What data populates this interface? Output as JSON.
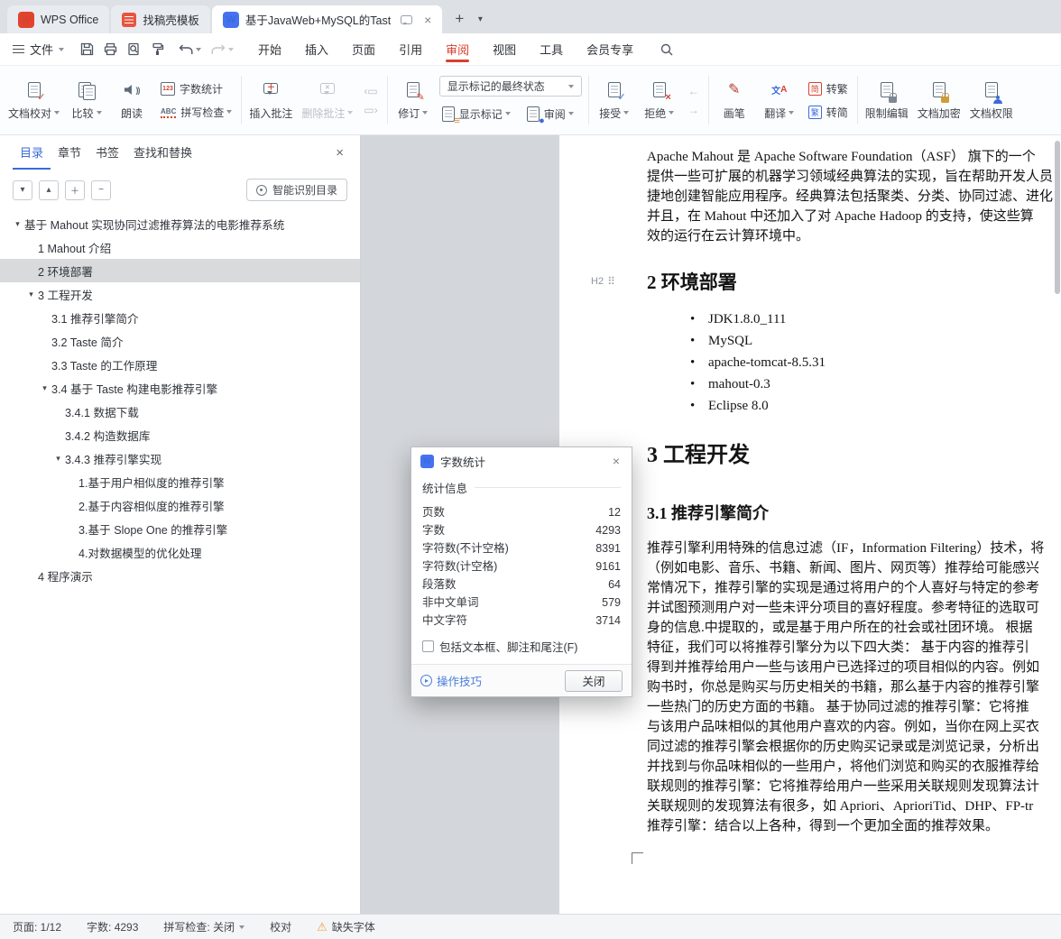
{
  "colors": {
    "accent_red": "#d8402e",
    "accent_blue": "#3b6bda",
    "selection_gray": "#d8dadb",
    "warning_orange": "#efa23b",
    "doc_bg": "#d3d6da"
  },
  "icons": {
    "wps-logo-icon": "red W badge",
    "writer-doc-icon": "blue W badge",
    "template-doc-icon": "red document",
    "search-icon": "magnifier",
    "warning-icon": "⚠",
    "caret-down-icon": "▾",
    "close-icon": "×",
    "check-icon": "✓",
    "lock-icon": "padlock",
    "speaker-icon": "speaker",
    "comment-icon": "speech bubble",
    "pencil-icon": "✎",
    "drag-handle-icon": "⠿"
  },
  "tabbar": {
    "home_label": "WPS Office",
    "template_label": "找稿壳模板",
    "doc_label": "基于JavaWeb+MySQL的Tast"
  },
  "menubar": {
    "file_label": "文件",
    "menus": [
      {
        "label": "开始"
      },
      {
        "label": "插入"
      },
      {
        "label": "页面"
      },
      {
        "label": "引用"
      },
      {
        "label": "审阅",
        "active": true
      },
      {
        "label": "视图"
      },
      {
        "label": "工具"
      },
      {
        "label": "会员专享"
      }
    ]
  },
  "ribbon": {
    "doc_check": "文档校对",
    "compare": "比较",
    "read_aloud": "朗读",
    "word_count": "字数统计",
    "spell_check": "拼写检查",
    "insert_comment": "插入批注",
    "delete_comment": "删除批注",
    "revision": "修订",
    "markup_state": "显示标记的最终状态",
    "show_markup": "显示标记",
    "review": "审阅",
    "accept": "接受",
    "reject": "拒绝",
    "pen": "画笔",
    "translate": "翻译",
    "to_traditional": "转繁",
    "to_simplified": "转简",
    "to_trad_icon": "简",
    "to_simp_icon": "繁",
    "restrict_edit": "限制编辑",
    "encrypt": "文档加密",
    "permission": "文档权限"
  },
  "sidebar": {
    "tabs": [
      {
        "label": "目录",
        "active": true
      },
      {
        "label": "章节"
      },
      {
        "label": "书签"
      },
      {
        "label": "查找和替换"
      }
    ],
    "smart_toc": "智能识别目录",
    "tree": [
      {
        "label": "基于 Mahout 实现协同过滤推荐算法的电影推荐系统",
        "level": 0,
        "caret": true
      },
      {
        "label": "1 Mahout 介绍",
        "level": 1
      },
      {
        "label": "2 环境部署",
        "level": 1,
        "selected": true
      },
      {
        "label": "3 工程开发",
        "level": 1,
        "caret": true
      },
      {
        "label": "3.1 推荐引擎简介",
        "level": 2
      },
      {
        "label": "3.2 Taste 简介",
        "level": 2
      },
      {
        "label": "3.3 Taste 的工作原理",
        "level": 2
      },
      {
        "label": "3.4 基于 Taste 构建电影推荐引擎",
        "level": 2,
        "caret": true
      },
      {
        "label": "3.4.1 数据下载",
        "level": 3
      },
      {
        "label": "3.4.2 构造数据库",
        "level": 3
      },
      {
        "label": "3.4.3 推荐引擎实现",
        "level": 3,
        "caret": true
      },
      {
        "label": "1.基于用户相似度的推荐引擎",
        "level": 4
      },
      {
        "label": "2.基于内容相似度的推荐引擎",
        "level": 4
      },
      {
        "label": "3.基于 Slope One 的推荐引擎",
        "level": 4
      },
      {
        "label": "4.对数据模型的优化处理",
        "level": 4
      },
      {
        "label": "4 程序演示",
        "level": 1
      }
    ]
  },
  "document": {
    "intro_lines": [
      "Apache Mahout 是  Apache Software Foundation（ASF） 旗下的一个",
      "提供一些可扩展的机器学习领域经典算法的实现，旨在帮助开发人员",
      "捷地创建智能应用程序。经典算法包括聚类、分类、协同过滤、进化",
      "并且，在 Mahout 中还加入了对 Apache Hadoop 的支持，使这些算",
      "效的运行在云计算环境中。"
    ],
    "h2_marker": "H2",
    "heading_env": "2 环境部署",
    "env_items": [
      "JDK1.8.0_111",
      "MySQL",
      "apache-tomcat-8.5.31",
      "mahout-0.3",
      "Eclipse 8.0"
    ],
    "heading_dev": "3 工程开发",
    "heading_intro": "3.1 推荐引擎简介",
    "body_lines": [
      "推荐引擎利用特殊的信息过滤（IF，Information Filtering）技术，将",
      "（例如电影、音乐、书籍、新闻、图片、网页等）推荐给可能感兴",
      "常情况下，推荐引擎的实现是通过将用户的个人喜好与特定的参考",
      "并试图预测用户对一些未评分项目的喜好程度。参考特征的选取可",
      "身的信息.中提取的，或是基于用户所在的社会或社团环境。 根据",
      "特征，我们可以将推荐引擎分为以下四大类： 基于内容的推荐引",
      "得到并推荐给用户一些与该用户已选择过的项目相似的内容。例如",
      "购书时，你总是购买与历史相关的书籍，那么基于内容的推荐引擎",
      "一些热门的历史方面的书籍。 基于协同过滤的推荐引擎：它将推",
      "与该用户品味相似的其他用户喜欢的内容。例如，当你在网上买衣",
      "同过滤的推荐引擎会根据你的历史购买记录或是浏览记录，分析出",
      "并找到与你品味相似的一些用户，将他们浏览和购买的衣服推荐给",
      "联规则的推荐引擎：它将推荐给用户一些采用关联规则发现算法计",
      "关联规则的发现算法有很多，如 Apriori、AprioriTid、DHP、FP-tr",
      "推荐引擎：结合以上各种，得到一个更加全面的推荐效果。"
    ]
  },
  "dialog": {
    "title": "字数统计",
    "section": "统计信息",
    "stats": [
      {
        "label": "页数",
        "value": "12"
      },
      {
        "label": "字数",
        "value": "4293"
      },
      {
        "label": "字符数(不计空格)",
        "value": "8391"
      },
      {
        "label": "字符数(计空格)",
        "value": "9161"
      },
      {
        "label": "段落数",
        "value": "64"
      },
      {
        "label": "非中文单词",
        "value": "579"
      },
      {
        "label": "中文字符",
        "value": "3714"
      }
    ],
    "checkbox_label": "包括文本框、脚注和尾注(F)",
    "tips_label": "操作技巧",
    "close_label": "关闭"
  },
  "statusbar": {
    "page": "页面: 1/12",
    "words": "字数: 4293",
    "spell": "拼写检查: 关闭",
    "proofread": "校对",
    "missing_font": "缺失字体"
  }
}
